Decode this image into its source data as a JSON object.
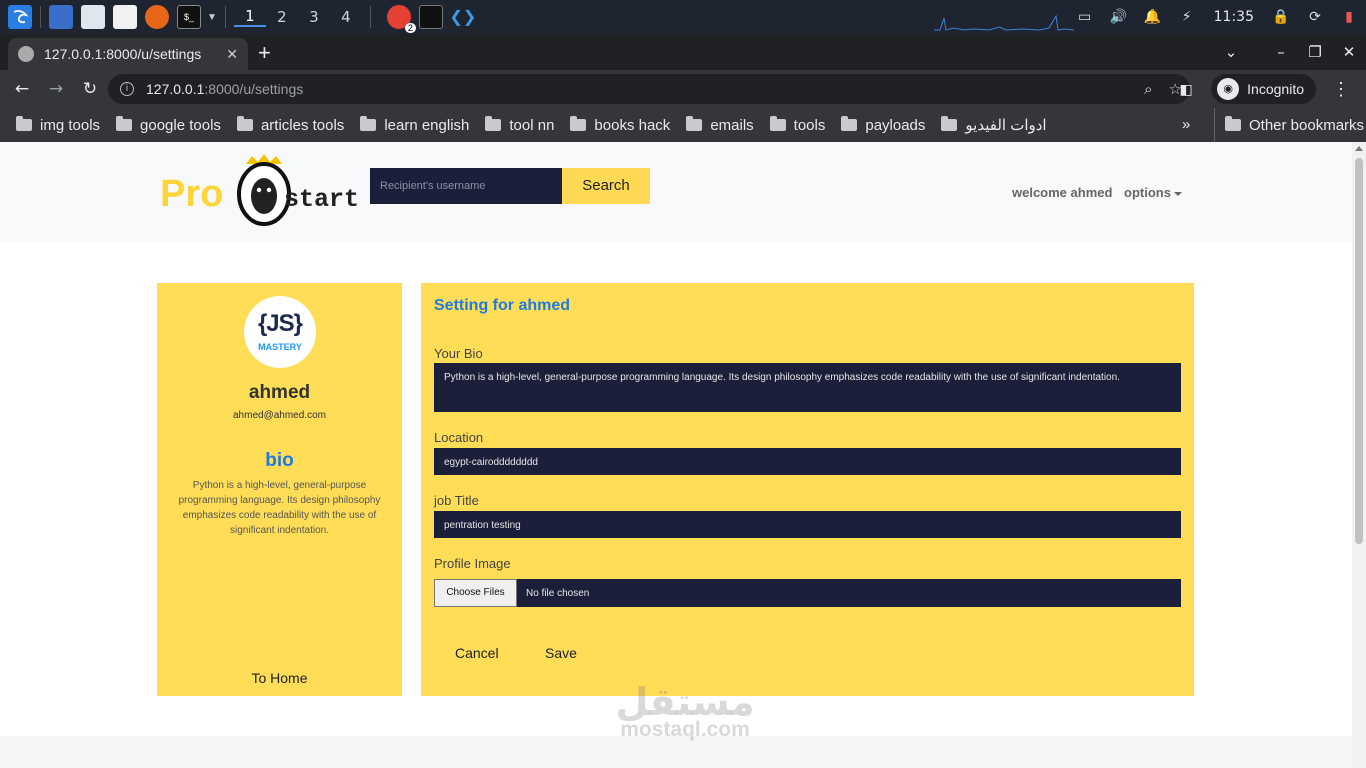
{
  "taskbar": {
    "workspaces": [
      "1",
      "2",
      "3",
      "4"
    ],
    "clock": "11:35",
    "chrome_badge": "2",
    "terminal_glyph": "$_"
  },
  "browser": {
    "tab_title": "127.0.0.1:8000/u/settings",
    "url_host": "127.0.0.1",
    "url_path": ":8000/u/settings",
    "profile_label": "Incognito",
    "bookmarks": [
      "img tools",
      "google tools",
      "articles tools",
      "learn english",
      "tool nn",
      "books hack",
      "emails",
      "tools",
      "payloads",
      "ادوات الفيديو"
    ],
    "other_bookmarks": "Other bookmarks"
  },
  "header": {
    "logo_left": "Pro",
    "logo_right": "start",
    "search_placeholder": "Recipient's username",
    "search_button": "Search",
    "welcome": "welcome ahmed",
    "options": "options"
  },
  "profile": {
    "avatar_top": "{JS}",
    "avatar_bottom": "MASTERY",
    "name": "ahmed",
    "email": "ahmed@ahmed.com",
    "bio_heading": "bio",
    "bio": "Python is a high-level, general-purpose programming language. Its design philosophy emphasizes code readability with the use of significant indentation.",
    "to_home": "To Home"
  },
  "settings": {
    "title": "Setting for ahmed",
    "bio_label": "Your Bio",
    "bio_value": "Python is a high-level, general-purpose programming language. Its design philosophy emphasizes code readability with the use of significant indentation.",
    "location_label": "Location",
    "location_value": "egypt-cairodddddddd",
    "job_label": "job Title",
    "job_value": "pentration testing",
    "image_label": "Profile Image",
    "choose_files": "Choose Files",
    "no_file": "No file chosen",
    "cancel": "Cancel",
    "save": "Save"
  },
  "watermark": {
    "arabic": "مستقل",
    "latin": "mostaql.com"
  }
}
